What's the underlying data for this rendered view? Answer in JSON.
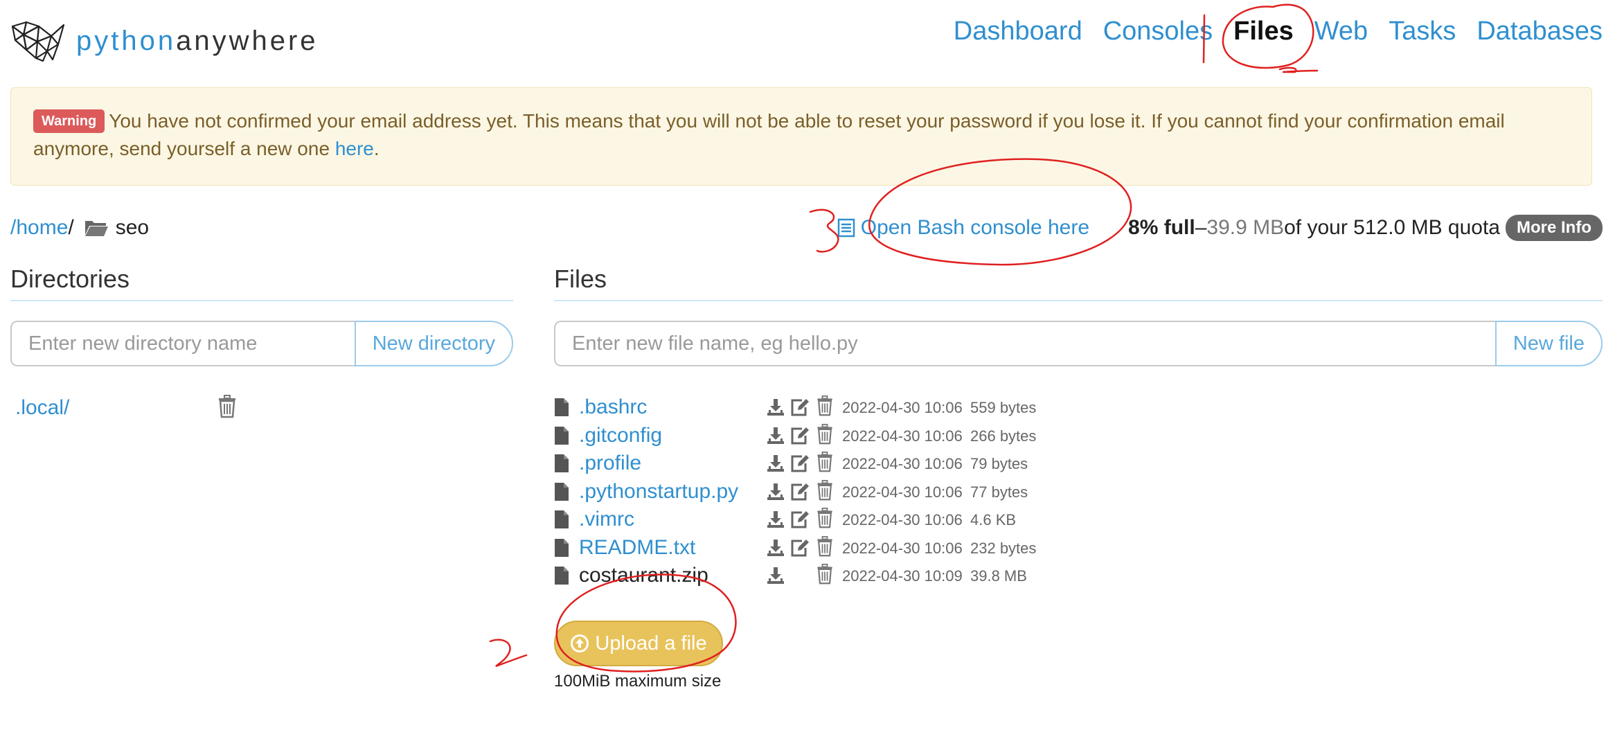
{
  "brand": {
    "name_part1": "python",
    "name_part2": "anywhere"
  },
  "nav": [
    {
      "label": "Dashboard",
      "active": false
    },
    {
      "label": "Consoles",
      "active": false
    },
    {
      "label": "Files",
      "active": true
    },
    {
      "label": "Web",
      "active": false
    },
    {
      "label": "Tasks",
      "active": false
    },
    {
      "label": "Databases",
      "active": false
    }
  ],
  "alert": {
    "badge": "Warning",
    "text": "You have not confirmed your email address yet. This means that you will not be able to reset your password if you lose it. If you cannot find your confirmation email anymore, send yourself a new one ",
    "link": "here",
    "suffix": "."
  },
  "breadcrumb": {
    "home": "/home",
    "separator": "/",
    "current": "seo",
    "folder_icon": "folder-open-icon"
  },
  "console": {
    "label": "Open Bash console here",
    "icon": "list-icon"
  },
  "quota": {
    "percent_full": "8% full",
    "dash": " – ",
    "used": "39.9 MB",
    "of_text": " of your 512.0 MB quota",
    "more_info": "More Info"
  },
  "directories": {
    "title": "Directories",
    "input_placeholder": "Enter new directory name",
    "button": "New directory",
    "items": [
      {
        "name": ".local/"
      }
    ]
  },
  "files": {
    "title": "Files",
    "input_placeholder": "Enter new file name, eg hello.py",
    "button": "New file",
    "items": [
      {
        "name": ".bashrc",
        "date": "2022-04-30 10:06",
        "size": "559 bytes",
        "editable": true
      },
      {
        "name": ".gitconfig",
        "date": "2022-04-30 10:06",
        "size": "266 bytes",
        "editable": true
      },
      {
        "name": ".profile",
        "date": "2022-04-30 10:06",
        "size": "79 bytes",
        "editable": true
      },
      {
        "name": ".pythonstartup.py",
        "date": "2022-04-30 10:06",
        "size": "77 bytes",
        "editable": true
      },
      {
        "name": ".vimrc",
        "date": "2022-04-30 10:06",
        "size": "4.6 KB",
        "editable": true
      },
      {
        "name": "README.txt",
        "date": "2022-04-30 10:06",
        "size": "232 bytes",
        "editable": true
      },
      {
        "name": "costaurant.zip",
        "date": "2022-04-30 10:09",
        "size": "39.8 MB",
        "editable": false
      }
    ]
  },
  "upload": {
    "label": "Upload a file",
    "note": "100MiB maximum size",
    "icon": "upload-circle-icon"
  },
  "colors": {
    "link": "#2f8fcf",
    "warning_bg": "#fcf7e4",
    "badge": "#dc5a5a",
    "upload": "#e8c35b",
    "annotation": "#e02020"
  }
}
